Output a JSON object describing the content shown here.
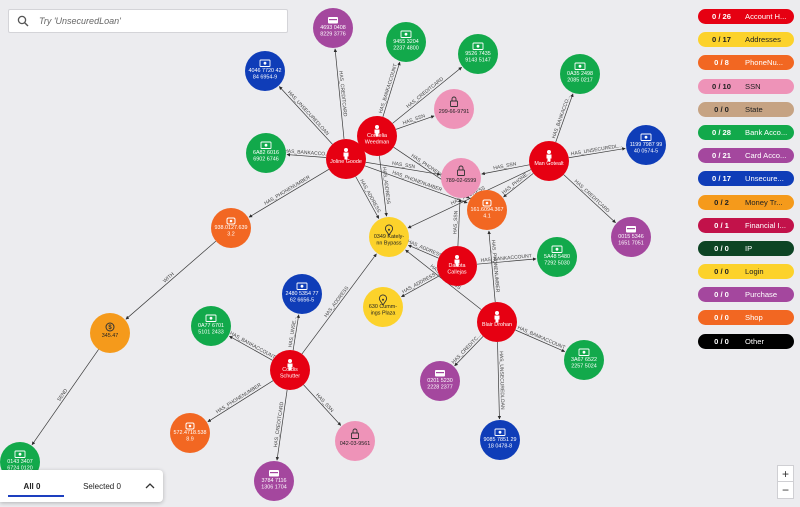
{
  "search": {
    "placeholder": "Try 'UnsecuredLoan'"
  },
  "legend": [
    {
      "count": "0 / 26",
      "label": "Account H...",
      "color": "#e60012",
      "dark": false
    },
    {
      "count": "0 / 17",
      "label": "Addresses",
      "color": "#fcd22b",
      "dark": true
    },
    {
      "count": "0 / 8",
      "label": "PhoneNu...",
      "color": "#f26722",
      "dark": false
    },
    {
      "count": "0 / 10",
      "label": "SSN",
      "color": "#ee93b8",
      "dark": true
    },
    {
      "count": "0 / 0",
      "label": "State",
      "color": "#c6a383",
      "dark": true
    },
    {
      "count": "0 / 28",
      "label": "Bank Acco...",
      "color": "#12a94b",
      "dark": false
    },
    {
      "count": "0 / 21",
      "label": "Card Acco...",
      "color": "#a4479e",
      "dark": false
    },
    {
      "count": "0 / 17",
      "label": "Unsecure...",
      "color": "#0f3db8",
      "dark": false
    },
    {
      "count": "0 / 2",
      "label": "Money Tr...",
      "color": "#f59a1b",
      "dark": true
    },
    {
      "count": "0 / 1",
      "label": "Financial I...",
      "color": "#c2124a",
      "dark": false
    },
    {
      "count": "0 / 0",
      "label": "IP",
      "color": "#0d4424",
      "dark": false
    },
    {
      "count": "0 / 0",
      "label": "Login",
      "color": "#fcd22b",
      "dark": true
    },
    {
      "count": "0 / 0",
      "label": "Purchase",
      "color": "#a4479e",
      "dark": false
    },
    {
      "count": "0 / 0",
      "label": "Shop",
      "color": "#f26722",
      "dark": false
    },
    {
      "count": "0 / 0",
      "label": "Other",
      "color": "#000000",
      "dark": false
    }
  ],
  "nodes": [
    {
      "id": "joline",
      "type": "person",
      "lines": [
        "Joline Goode"
      ]
    },
    {
      "id": "cornelia",
      "type": "person",
      "lines": [
        "Cornelia",
        "Weedman"
      ]
    },
    {
      "id": "man",
      "type": "person",
      "lines": [
        "Man Gotealt"
      ]
    },
    {
      "id": "dakota",
      "type": "person",
      "lines": [
        "Dakota",
        "Callejas"
      ]
    },
    {
      "id": "blair",
      "type": "person",
      "lines": [
        "Blair Drohan"
      ]
    },
    {
      "id": "cordis",
      "type": "person",
      "lines": [
        "Cordis",
        "Schutter"
      ]
    },
    {
      "id": "ssn1",
      "type": "ssn",
      "lines": [
        "299-66-9791"
      ]
    },
    {
      "id": "ssn2",
      "type": "ssn",
      "lines": [
        "789-02-6599"
      ]
    },
    {
      "id": "ssn3",
      "type": "ssn",
      "lines": [
        "042-03-9561"
      ]
    },
    {
      "id": "phone1",
      "type": "phone",
      "lines": [
        "938.0127.639",
        "3.2"
      ]
    },
    {
      "id": "phone2",
      "type": "phone",
      "lines": [
        "161.6094.367",
        "4.1"
      ]
    },
    {
      "id": "phone3",
      "type": "phone",
      "lines": [
        "572.4718.538",
        "8.9"
      ]
    },
    {
      "id": "addr1",
      "type": "address",
      "lines": [
        "0349 Kately-",
        "nn Bypass"
      ]
    },
    {
      "id": "addr2",
      "type": "address",
      "lines": [
        "630 Cumm-",
        "ings Plaza"
      ]
    },
    {
      "id": "money",
      "type": "money",
      "lines": [
        "345.47"
      ]
    },
    {
      "id": "card1",
      "type": "card",
      "lines": [
        "4693 0408",
        "8229 3776"
      ]
    },
    {
      "id": "card2",
      "type": "card",
      "lines": [
        "0015 5346",
        "1651 7051"
      ]
    },
    {
      "id": "card3",
      "type": "card",
      "lines": [
        "0201 5230",
        "2228 2377"
      ]
    },
    {
      "id": "card4",
      "type": "card",
      "lines": [
        "3784 7116",
        "1306 1704"
      ]
    },
    {
      "id": "bank1",
      "type": "bank",
      "lines": [
        "9455 3204",
        "2237 4800"
      ]
    },
    {
      "id": "bank2",
      "type": "bank",
      "lines": [
        "9526 7435",
        "9143 5147"
      ]
    },
    {
      "id": "bank3",
      "type": "bank",
      "lines": [
        "0A35 2498",
        "2085 0217"
      ]
    },
    {
      "id": "bank4",
      "type": "bank",
      "lines": [
        "6A82 6016",
        "6902 6746"
      ]
    },
    {
      "id": "bank5",
      "type": "bank",
      "lines": [
        "5A48 5480",
        "7292 5030"
      ]
    },
    {
      "id": "bank6",
      "type": "bank",
      "lines": [
        "0A77 6701",
        "5101 2433"
      ]
    },
    {
      "id": "bank7",
      "type": "bank",
      "lines": [
        "3A67 6522",
        "2257 5024"
      ]
    },
    {
      "id": "bank8",
      "type": "bank",
      "lines": [
        "0143 3407",
        "6724 0120"
      ]
    },
    {
      "id": "loan1",
      "type": "loan",
      "lines": [
        "4046 7720 42",
        "84 6954-9"
      ]
    },
    {
      "id": "loan2",
      "type": "loan",
      "lines": [
        "1199 7987 99",
        "40 0574-5"
      ]
    },
    {
      "id": "loan3",
      "type": "loan",
      "lines": [
        "2480 5354 77",
        "62 6656-5"
      ]
    },
    {
      "id": "loan4",
      "type": "loan",
      "lines": [
        "9085 7851 29",
        "18 0478-8"
      ]
    }
  ],
  "edges": [
    {
      "from": "joline",
      "to": "loan1",
      "label": "HAS_UNSECUREDLOAN"
    },
    {
      "from": "joline",
      "to": "card1",
      "label": "HAS_CREDITCARD"
    },
    {
      "from": "joline",
      "to": "bank4",
      "label": "HAS_BANKACCO..."
    },
    {
      "from": "joline",
      "to": "phone1",
      "label": "HAS_PHONENUMBER"
    },
    {
      "from": "joline",
      "to": "ssn2",
      "label": "HAS_SSN"
    },
    {
      "from": "joline",
      "to": "addr1",
      "label": "HAS_ADDRESS"
    },
    {
      "from": "joline",
      "to": "phone2",
      "label": "HAS_PHONENUMBER"
    },
    {
      "from": "cornelia",
      "to": "bank1",
      "label": "HAS_BANKACCOUNT"
    },
    {
      "from": "cornelia",
      "to": "bank2",
      "label": "HAS_CREDITCARD"
    },
    {
      "from": "cornelia",
      "to": "ssn1",
      "label": "HAS_SSN"
    },
    {
      "from": "cornelia",
      "to": "addr1",
      "label": "HAS_ADDRESS"
    },
    {
      "from": "cornelia",
      "to": "phone2",
      "label": "HAS_PHONENUMBER"
    },
    {
      "from": "man",
      "to": "bank3",
      "label": "HAS_BANKACCO..."
    },
    {
      "from": "man",
      "to": "loan2",
      "label": "HAS_UNSECUREDL..."
    },
    {
      "from": "man",
      "to": "card2",
      "label": "HAS_CREDITCARD"
    },
    {
      "from": "man",
      "to": "ssn2",
      "label": "HAS_SSN"
    },
    {
      "from": "man",
      "to": "phone2",
      "label": "HAS_PHONE..."
    },
    {
      "from": "man",
      "to": "addr1",
      "label": "HAS_ADDRESS"
    },
    {
      "from": "dakota",
      "to": "ssn2",
      "label": "HAS_SSN"
    },
    {
      "from": "dakota",
      "to": "bank5",
      "label": "HAS_BANKACCOUNT"
    },
    {
      "from": "dakota",
      "to": "addr2",
      "label": "HAS_ADDRESS"
    },
    {
      "from": "dakota",
      "to": "addr1",
      "label": "HAS_ADDRESS"
    },
    {
      "from": "blair",
      "to": "addr1",
      "label": "HAS_ADDRESS"
    },
    {
      "from": "blair",
      "to": "phone2",
      "label": "HAS_PHONENUMBER"
    },
    {
      "from": "blair",
      "to": "bank7",
      "label": "HAS_BANKACCOUNT"
    },
    {
      "from": "blair",
      "to": "card3",
      "label": "HAS_CREDITC..."
    },
    {
      "from": "blair",
      "to": "loan4",
      "label": "HAS_UNSECUREDLOAN"
    },
    {
      "from": "cordis",
      "to": "loan3",
      "label": "HAS_UNSE..."
    },
    {
      "from": "cordis",
      "to": "addr1",
      "label": "HAS_ADDRESS"
    },
    {
      "from": "cordis",
      "to": "bank6",
      "label": "HAS_BANKACCOUNT"
    },
    {
      "from": "cordis",
      "to": "phone3",
      "label": "HAS_PHONENUMBER"
    },
    {
      "from": "cordis",
      "to": "card4",
      "label": "HAS_CREDITCARD"
    },
    {
      "from": "cordis",
      "to": "ssn3",
      "label": "HAS_SSN"
    },
    {
      "from": "phone1",
      "to": "money",
      "label": "WITH"
    },
    {
      "from": "money",
      "to": "bank8",
      "label": "SEND"
    }
  ],
  "bottom": {
    "all_label": "All 0",
    "selected_label": "Selected 0"
  },
  "zoom": {
    "in_label": "+",
    "out_label": "−"
  },
  "colors": {
    "person": "#e60012",
    "address": "#fcd22b",
    "phone": "#f26722",
    "ssn": "#ee93b8",
    "bank": "#12a94b",
    "card": "#a4479e",
    "loan": "#0f3db8",
    "money": "#f59a1b"
  }
}
